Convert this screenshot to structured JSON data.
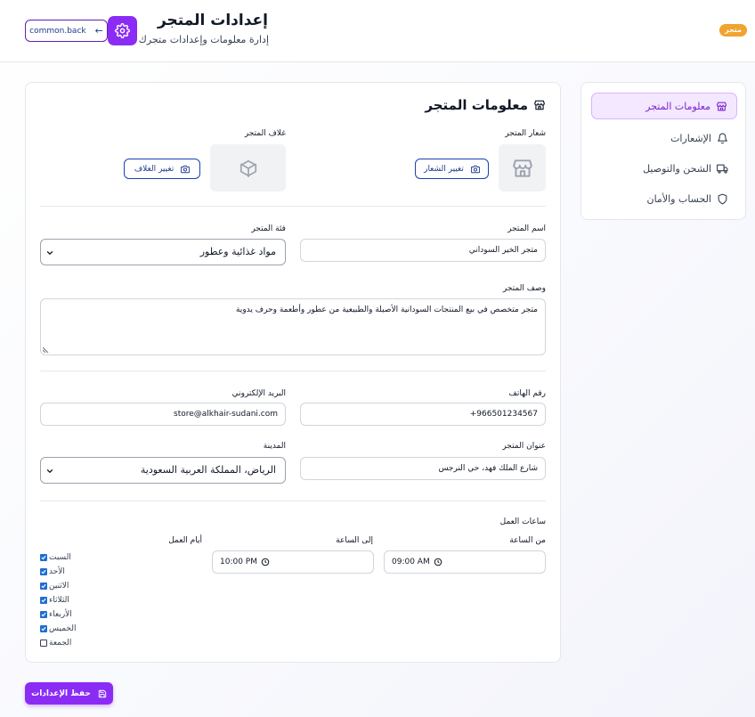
{
  "header": {
    "badge": "متجر",
    "back_label": "common.back",
    "title": "إعدادات المتجر",
    "subtitle": "إدارة معلومات وإعدادات متجرك"
  },
  "sidebar": {
    "items": [
      {
        "label": "معلومات المتجر",
        "icon": "store-icon",
        "active": true
      },
      {
        "label": "الإشعارات",
        "icon": "bell-icon",
        "active": false
      },
      {
        "label": "الشحن والتوصيل",
        "icon": "truck-icon",
        "active": false
      },
      {
        "label": "الحساب والأمان",
        "icon": "shield-icon",
        "active": false
      }
    ]
  },
  "section": {
    "title": "معلومات المتجر",
    "logo_label": "شعار المتجر",
    "change_logo": "تغيير الشعار",
    "cover_label": "غلاف المتجر",
    "change_cover": "تغيير الغلاف",
    "name_label": "اسم المتجر",
    "name_value": "متجر الخير السوداني",
    "category_label": "فئة المتجر",
    "category_value": "مواد غذائية وعطور",
    "description_label": "وصف المتجر",
    "description_value": "متجر متخصص في بيع المنتجات السودانية الأصيلة والطبيعية من عطور وأطعمة وحرف يدوية",
    "phone_label": "رقم الهاتف",
    "phone_value": "+966501234567",
    "email_label": "البريد الإلكتروني",
    "email_value": "store@alkhair-sudani.com",
    "address_label": "عنوان المتجر",
    "address_value": "شارع الملك فهد، حي النرجس",
    "city_label": "المدينة",
    "city_value": "الرياض، المملكة العربية السعودية",
    "hours_label": "ساعات العمل",
    "from_label": "من الساعة",
    "from_value": "09:00 AM",
    "to_label": "إلى الساعة",
    "to_value": "10:00 PM",
    "days_label": "أيام العمل",
    "days": [
      {
        "label": "السبت",
        "checked": true
      },
      {
        "label": "الأحد",
        "checked": true
      },
      {
        "label": "الاثنين",
        "checked": true
      },
      {
        "label": "الثلاثاء",
        "checked": true
      },
      {
        "label": "الأربعاء",
        "checked": true
      },
      {
        "label": "الخميس",
        "checked": true
      },
      {
        "label": "الجمعة",
        "checked": false
      }
    ]
  },
  "save_label": "حفظ الإعدادات",
  "colors": {
    "accent": "#8b2cf5",
    "badge": "#f0a32e",
    "active_bg": "#f3e8ff"
  }
}
